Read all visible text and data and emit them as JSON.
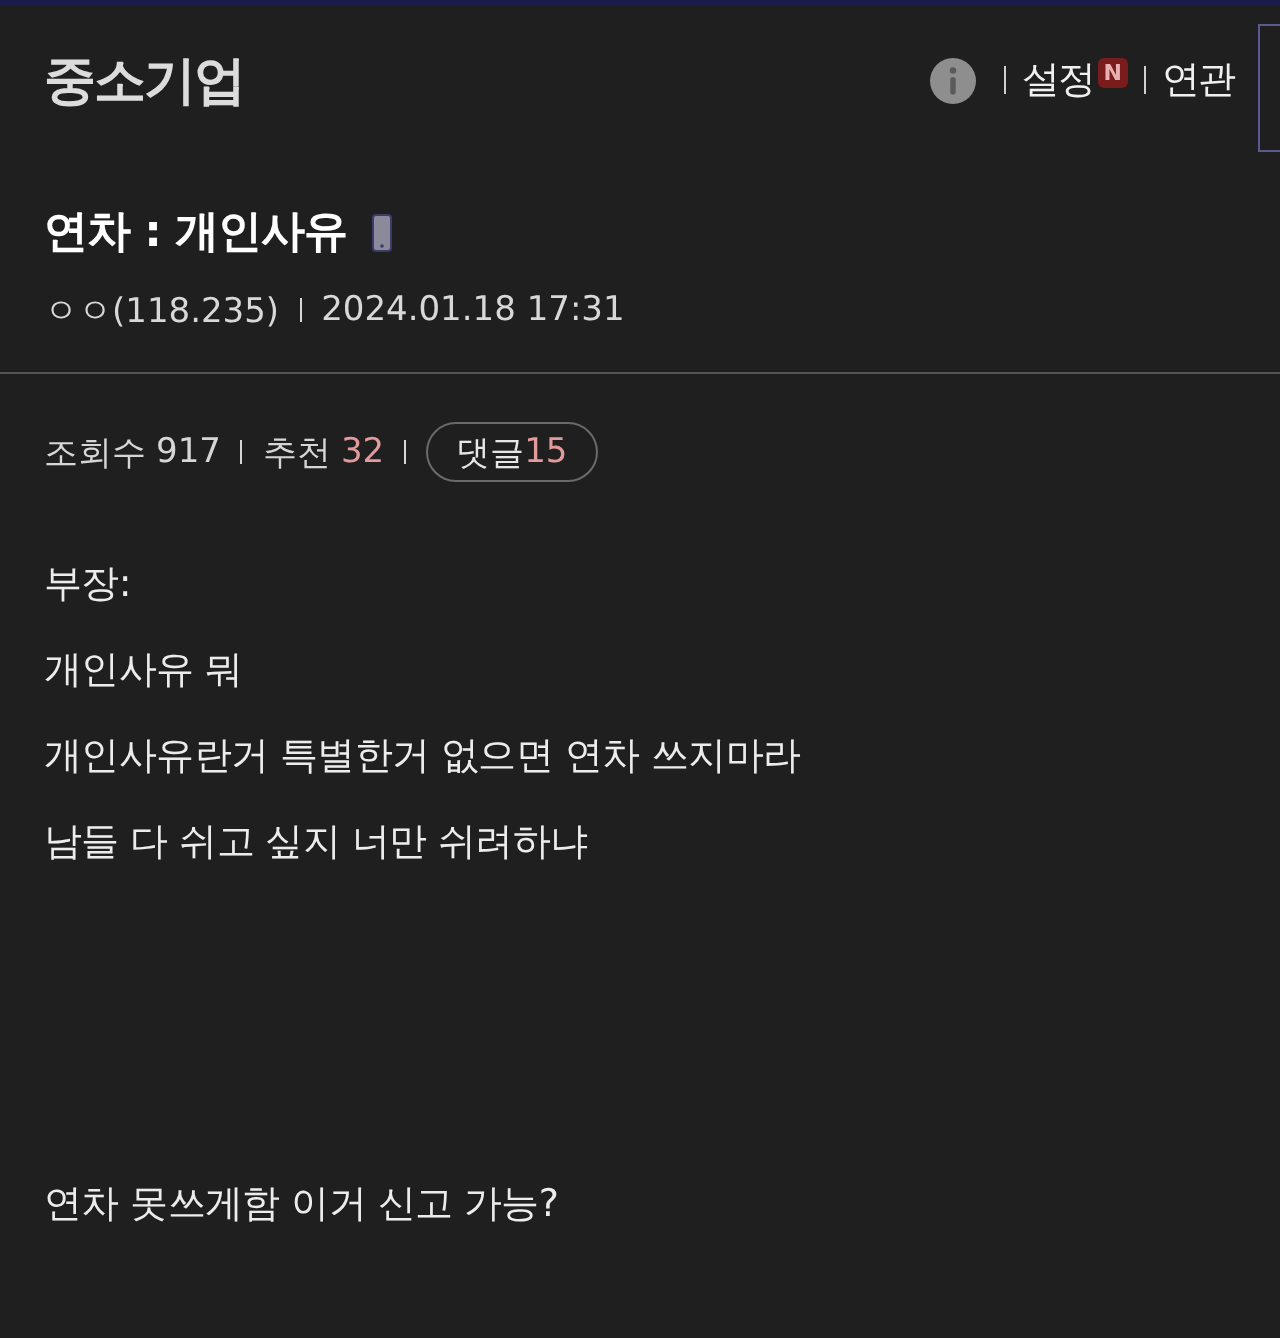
{
  "header": {
    "board_name": "중소기업",
    "menu": [
      {
        "label": "설정",
        "badge": "N"
      },
      {
        "label": "연관"
      }
    ]
  },
  "post": {
    "title": "연차 : 개인사유",
    "writer": "ㅇㅇ(118.235)",
    "date": "2024.01.18 17:31",
    "stats": [
      {
        "kind": "plain",
        "label": "조회수",
        "value": "917",
        "highlight": false
      },
      {
        "kind": "plain",
        "label": "추천",
        "value": "32",
        "highlight": true
      },
      {
        "kind": "pill",
        "label": "댓글",
        "value": "15",
        "highlight": true
      }
    ],
    "body": [
      [
        "부장:",
        "개인사유 뭐",
        "개인사유란거 특별한거 없으면 연차 쓰지마라",
        "남들 다 쉬고 싶지 너만 쉬려하냐"
      ],
      [
        "연차 못쓰게함 이거 신고 가능?"
      ]
    ]
  }
}
